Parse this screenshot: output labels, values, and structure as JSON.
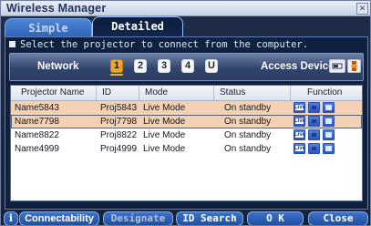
{
  "window": {
    "title": "Wireless Manager",
    "close_glyph": "✕"
  },
  "tabs": [
    {
      "label": "Simple"
    },
    {
      "label": "Detailed"
    }
  ],
  "instruction": "Select the projector to connect from the computer.",
  "network": {
    "label": "Network",
    "buttons": [
      "1",
      "2",
      "3",
      "4",
      "U"
    ],
    "selected": "1",
    "access_label": "Access Device",
    "access_icons": [
      "pc-card-icon",
      "usb-device-icon"
    ]
  },
  "table": {
    "headers": [
      "Projector Name",
      "ID",
      "Mode",
      "Status",
      "Function"
    ],
    "rows": [
      {
        "name": "Name5843",
        "id": "Proj5843",
        "mode": "Live Mode",
        "status": "On standby",
        "selected": true
      },
      {
        "name": "Name7798",
        "id": "Proj7798",
        "mode": "Live Mode",
        "status": "On standby",
        "selected": true
      },
      {
        "name": "Name8822",
        "id": "Proj8822",
        "mode": "Live Mode",
        "status": "On standby",
        "selected": false
      },
      {
        "name": "Name4999",
        "id": "Proj4999",
        "mode": "Live Mode",
        "status": "On standby",
        "selected": false
      }
    ],
    "function_icons": [
      {
        "name": "live-icon",
        "text": "Live"
      },
      {
        "name": "screen-icon",
        "text": ""
      },
      {
        "name": "multi-screen-icon",
        "text": ""
      }
    ]
  },
  "bottom": {
    "info": "i",
    "connectability": "Connectability",
    "designate": "Designate",
    "id_search": "ID Search",
    "ok": "O K",
    "close": "Close"
  },
  "colors": {
    "selected_row": "#f5d1b4",
    "network_active": "#f0a62a",
    "button_blue": "#2f63b8",
    "panel": "#10213f"
  }
}
